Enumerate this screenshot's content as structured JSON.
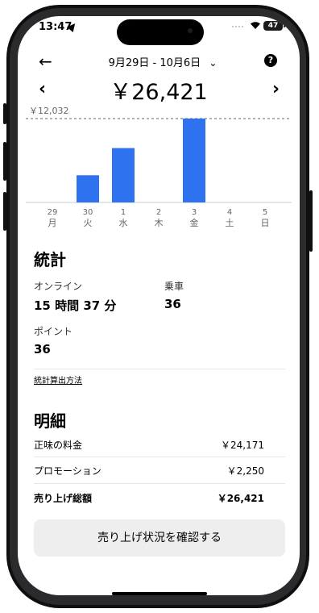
{
  "status_bar": {
    "time": "13:47",
    "battery": "47",
    "wifi_icon": "wifi-icon"
  },
  "header": {
    "date_range": "9月29日 - 10月6日",
    "dropdown_glyph": "⌄",
    "back_glyph": "←",
    "help_glyph": "?"
  },
  "earnings": {
    "total": "￥26,421",
    "prev_glyph": "‹",
    "next_glyph": "›"
  },
  "chart_data": {
    "type": "bar",
    "categories": [
      "29",
      "30",
      "1",
      "2",
      "3",
      "4",
      "5"
    ],
    "weekdays": [
      "月",
      "火",
      "水",
      "木",
      "金",
      "土",
      "日"
    ],
    "values": [
      0,
      3900,
      7800,
      0,
      12032,
      0,
      0
    ],
    "reference_line": {
      "value": 12032,
      "label": "￥12,032"
    },
    "bar_color": "#2f72f0",
    "ylim": [
      0,
      12032
    ]
  },
  "stats": {
    "title": "統計",
    "online_label": "オンライン",
    "online_value": "15 時間 37 分",
    "rides_label": "乗車",
    "rides_value": "36",
    "points_label": "ポイント",
    "points_value": "36",
    "method_link": "統計算出方法"
  },
  "breakdown": {
    "title": "明細",
    "rows": [
      {
        "label": "正味の料金",
        "value": "￥24,171"
      },
      {
        "label": "プロモーション",
        "value": "￥2,250"
      },
      {
        "label": "売り上げ総額",
        "value": "￥26,421"
      }
    ]
  },
  "cta": {
    "label": "売り上げ状況を確認する"
  }
}
